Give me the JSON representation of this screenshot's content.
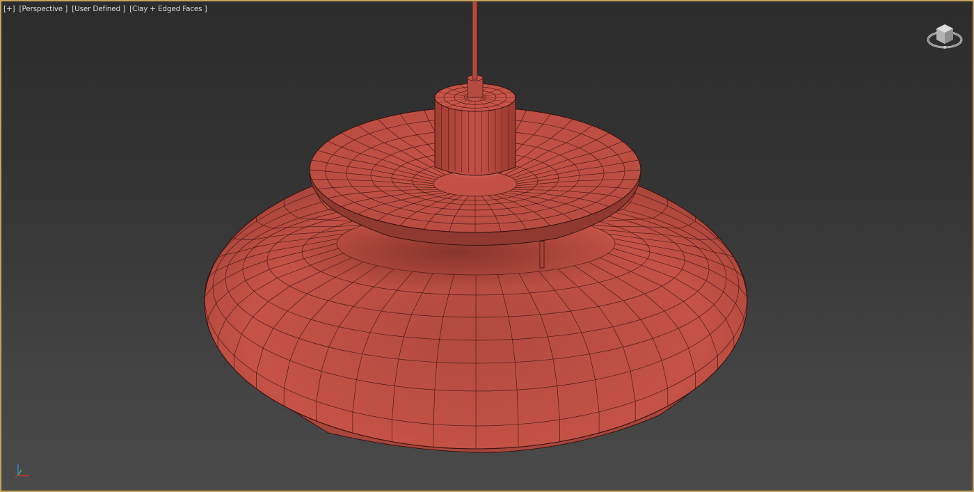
{
  "viewport": {
    "labels": [
      {
        "id": "plus",
        "text": "[+]"
      },
      {
        "id": "perspective",
        "text": "[Perspective ]"
      },
      {
        "id": "user-defined",
        "text": "[User Defined ]"
      },
      {
        "id": "shading",
        "text": "[Clay + Edged Faces ]"
      }
    ],
    "colors": {
      "frame": "#c8a45a",
      "clay_fill": "#c04f43",
      "clay_edge": "#3a1410",
      "background_top": "#2c2c2c",
      "background_bottom": "#4a4a4a"
    },
    "icons": {
      "viewcube": "viewcube-icon",
      "axis": "axis-tripod-icon"
    }
  },
  "model": {
    "object": "pendant-lamp",
    "parts": [
      "cable",
      "top-cylinder",
      "upper-shade",
      "lower-shade",
      "support-rod"
    ]
  }
}
